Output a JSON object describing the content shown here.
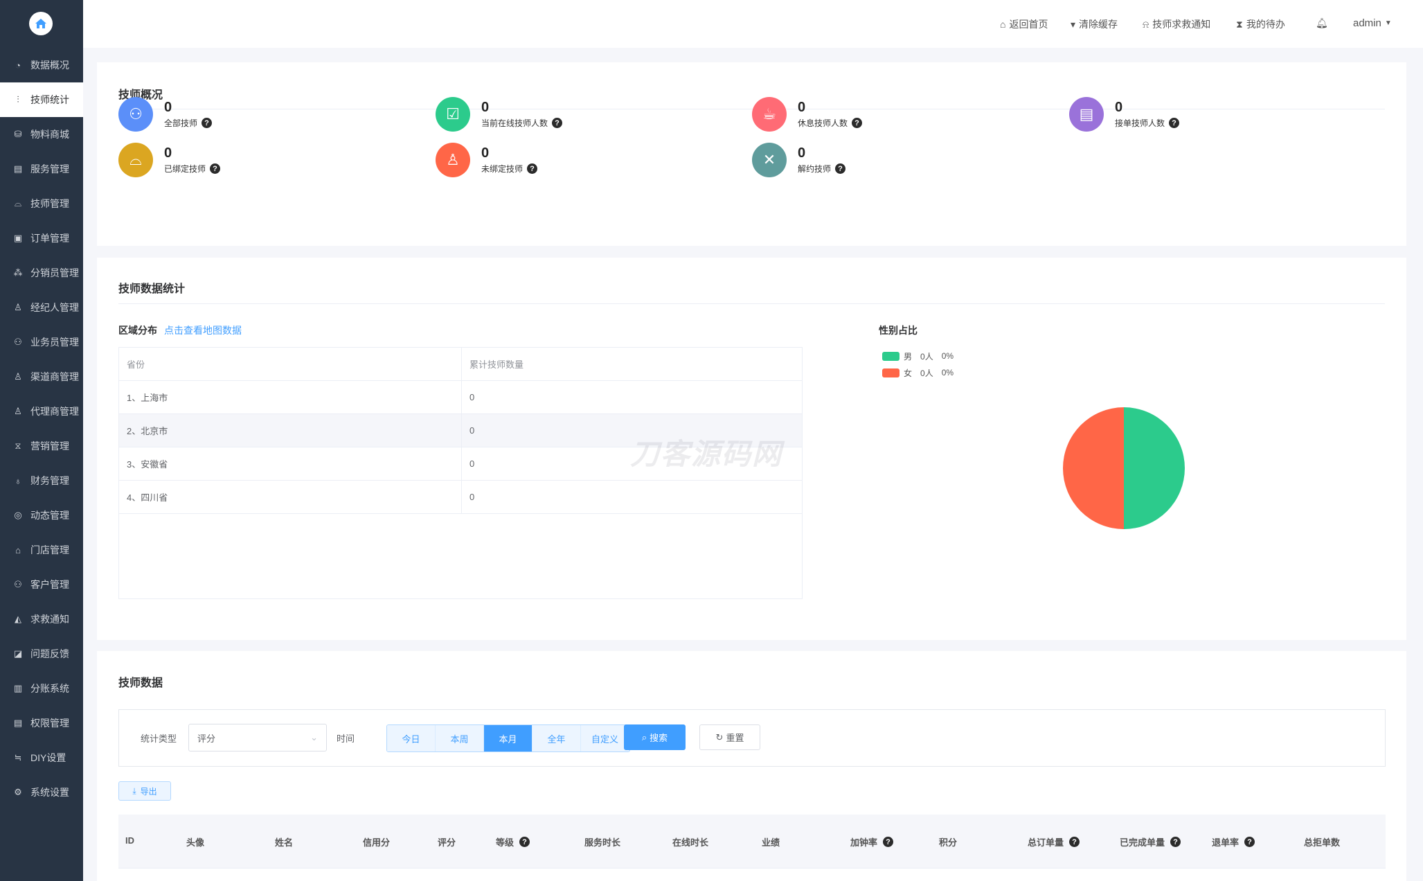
{
  "sidebar": {
    "items": [
      {
        "label": "数据概况",
        "icon": "pie-chart-icon"
      },
      {
        "label": "技师统计",
        "icon": "stats-icon",
        "active": true
      },
      {
        "label": "物料商城",
        "icon": "shop-bag-icon"
      },
      {
        "label": "服务管理",
        "icon": "service-icon"
      },
      {
        "label": "技师管理",
        "icon": "technician-icon"
      },
      {
        "label": "订单管理",
        "icon": "clipboard-icon"
      },
      {
        "label": "分销员管理",
        "icon": "distributor-icon"
      },
      {
        "label": "经纪人管理",
        "icon": "agent-icon"
      },
      {
        "label": "业务员管理",
        "icon": "salesman-icon"
      },
      {
        "label": "渠道商管理",
        "icon": "channel-icon"
      },
      {
        "label": "代理商管理",
        "icon": "proxy-icon"
      },
      {
        "label": "营销管理",
        "icon": "marketing-icon"
      },
      {
        "label": "财务管理",
        "icon": "finance-icon"
      },
      {
        "label": "动态管理",
        "icon": "compass-icon"
      },
      {
        "label": "门店管理",
        "icon": "store-icon"
      },
      {
        "label": "客户管理",
        "icon": "customers-icon"
      },
      {
        "label": "求救通知",
        "icon": "bell-icon"
      },
      {
        "label": "问题反馈",
        "icon": "feedback-icon"
      },
      {
        "label": "分账系统",
        "icon": "split-account-icon"
      },
      {
        "label": "权限管理",
        "icon": "permission-icon"
      },
      {
        "label": "DIY设置",
        "icon": "diy-icon"
      },
      {
        "label": "系统设置",
        "icon": "gear-icon"
      }
    ]
  },
  "header": {
    "home": "返回首页",
    "clear_cache": "清除缓存",
    "sos": "技师求救通知",
    "todo": "我的待办",
    "user": "admin"
  },
  "overview": {
    "title": "技师概况",
    "stats": [
      {
        "value": "0",
        "label": "全部技师",
        "color": "#5b8ff9"
      },
      {
        "value": "0",
        "label": "当前在线技师人数",
        "color": "#2ccb8c"
      },
      {
        "value": "0",
        "label": "休息技师人数",
        "color": "#ff6b75"
      },
      {
        "value": "0",
        "label": "接单技师人数",
        "color": "#9a72da"
      },
      {
        "value": "0",
        "label": "已绑定技师",
        "color": "#dba621"
      },
      {
        "value": "0",
        "label": "未绑定技师",
        "color": "#ff6647"
      },
      {
        "value": "0",
        "label": "解约技师",
        "color": "#5f9c9c"
      }
    ]
  },
  "stats": {
    "title": "技师数据统计",
    "region_label": "区域分布",
    "map_link": "点击查看地图数据",
    "table": {
      "headers": [
        "省份",
        "累计技师数量"
      ],
      "rows": [
        [
          "1、上海市",
          "0"
        ],
        [
          "2、北京市",
          "0"
        ],
        [
          "3、安徽省",
          "0"
        ],
        [
          "4、四川省",
          "0"
        ]
      ]
    },
    "watermark": "刀客源码网",
    "gender": {
      "title": "性别占比",
      "legend": [
        {
          "name": "男",
          "count": "0人",
          "pct": "0%",
          "color": "#2ccb8c"
        },
        {
          "name": "女",
          "count": "0人",
          "pct": "0%",
          "color": "#ff6647"
        }
      ]
    }
  },
  "chart_data": {
    "type": "pie",
    "title": "性别占比",
    "legend_position": "top-left",
    "slices": [
      {
        "name": "男",
        "value": 0,
        "display_share": 50,
        "color": "#2ccb8c"
      },
      {
        "name": "女",
        "value": 0,
        "display_share": 50,
        "color": "#ff6647"
      }
    ]
  },
  "techdata": {
    "title": "技师数据",
    "type_label": "统计类型",
    "type_value": "评分",
    "time_label": "时间",
    "periods": [
      "今日",
      "本周",
      "本月",
      "全年",
      "自定义"
    ],
    "active_period": "本月",
    "search": "搜索",
    "reset": "重置",
    "export": "导出",
    "columns": [
      {
        "label": "ID"
      },
      {
        "label": "头像"
      },
      {
        "label": "姓名"
      },
      {
        "label": "信用分"
      },
      {
        "label": "评分"
      },
      {
        "label": "等级",
        "help": true
      },
      {
        "label": "服务时长"
      },
      {
        "label": "在线时长"
      },
      {
        "label": "业绩"
      },
      {
        "label": "加钟率",
        "help": true
      },
      {
        "label": "积分"
      },
      {
        "label": "总订单量",
        "help": true
      },
      {
        "label": "已完成单量",
        "help": true
      },
      {
        "label": "退单率",
        "help": true
      },
      {
        "label": "总拒单数"
      }
    ]
  }
}
